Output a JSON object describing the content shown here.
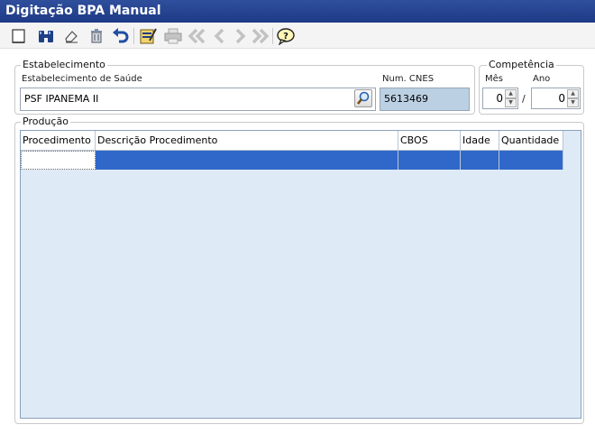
{
  "window": {
    "title": "Digitação BPA Manual"
  },
  "toolbar": {
    "buttons": [
      {
        "icon": "new-icon"
      },
      {
        "icon": "binoculars-icon"
      },
      {
        "icon": "eraser-icon"
      },
      {
        "icon": "trash-icon"
      },
      {
        "icon": "undo-icon"
      },
      {
        "icon": "edit-icon"
      },
      {
        "icon": "print-icon"
      },
      {
        "icon": "first-icon"
      },
      {
        "icon": "prev-icon"
      },
      {
        "icon": "next-icon"
      },
      {
        "icon": "last-icon"
      },
      {
        "icon": "help-icon"
      }
    ]
  },
  "estabelecimento": {
    "group_label": "Estabelecimento",
    "estab_label": "Estabelecimento de Saúde",
    "estab_value": "PSF IPANEMA II",
    "cnes_label": "Num. CNES",
    "cnes_value": "5613469"
  },
  "competencia": {
    "group_label": "Competência",
    "mes_label": "Mês",
    "ano_label": "Ano",
    "mes_value": "0",
    "ano_value": "0",
    "separator": "/"
  },
  "producao": {
    "group_label": "Produção",
    "columns": [
      "Procedimento",
      "Descrição Procedimento",
      "CBOS",
      "Idade",
      "Quantidade"
    ]
  },
  "colors": {
    "title_bar": "#1e3a86",
    "selection": "#2f68c9",
    "grid_bg": "#deeaf6",
    "readonly_field": "#bcd0e3"
  }
}
